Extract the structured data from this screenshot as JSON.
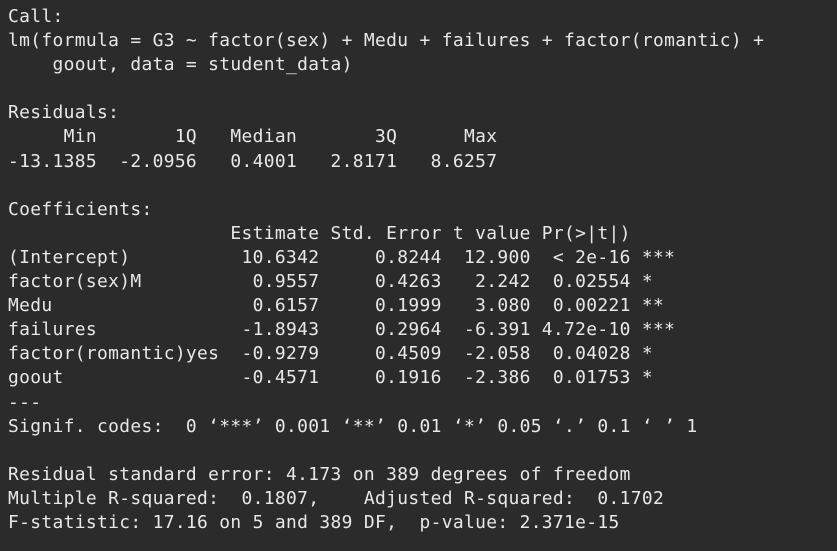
{
  "console": {
    "lines": [
      "Call:",
      "lm(formula = G3 ~ factor(sex) + Medu + failures + factor(romantic) +",
      "    goout, data = student_data)",
      "",
      "Residuals:",
      "     Min       1Q   Median       3Q      Max",
      "-13.1385  -2.0956   0.4001   2.8171   8.6257",
      "",
      "Coefficients:",
      "                    Estimate Std. Error t value Pr(>|t|)",
      "(Intercept)          10.6342     0.8244  12.900  < 2e-16 ***",
      "factor(sex)M          0.9557     0.4263   2.242  0.02554 *",
      "Medu                  0.6157     0.1999   3.080  0.00221 **",
      "failures             -1.8943     0.2964  -6.391 4.72e-10 ***",
      "factor(romantic)yes  -0.9279     0.4509  -2.058  0.04028 *",
      "goout                -0.4571     0.1916  -2.386  0.01753 *",
      "---",
      "Signif. codes:  0 ‘***’ 0.001 ‘**’ 0.01 ‘*’ 0.05 ‘.’ 0.1 ‘ ’ 1",
      "",
      "Residual standard error: 4.173 on 389 degrees of freedom",
      "Multiple R-squared:  0.1807,    Adjusted R-squared:  0.1702",
      "F-statistic: 17.16 on 5 and 389 DF,  p-value: 2.371e-15"
    ]
  },
  "colors": {
    "background": "#2b2b2b",
    "text": "#e8e8e8"
  }
}
